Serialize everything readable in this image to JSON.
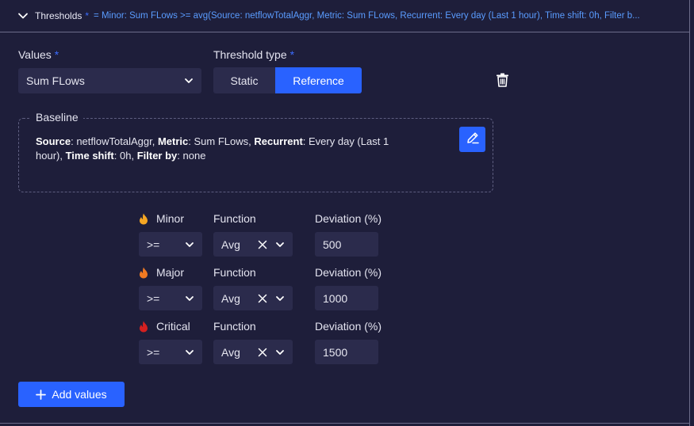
{
  "header": {
    "title": "Thresholds",
    "required_mark": "*",
    "summary": "= Minor: Sum FLows >= avg(Source: netflowTotalAggr, Metric: Sum FLows, Recurrent: Every day (Last 1 hour), Time shift: 0h, Filter b..."
  },
  "values_field": {
    "label": "Values",
    "required_mark": "*",
    "selected": "Sum FLows"
  },
  "threshold_type": {
    "label": "Threshold type",
    "required_mark": "*",
    "options": [
      "Static",
      "Reference"
    ],
    "selected": "Reference"
  },
  "baseline": {
    "legend": "Baseline",
    "source_label": "Source",
    "source": "netflowTotalAggr",
    "metric_label": "Metric",
    "metric": "Sum FLows",
    "recurrent_label": "Recurrent",
    "recurrent_a": "Every day (Last 1",
    "recurrent_b": "hour)",
    "time_shift_label": "Time shift",
    "time_shift": "0h",
    "filter_label": "Filter by",
    "filter": "none"
  },
  "severities": [
    {
      "name": "Minor",
      "operator": ">=",
      "function_label": "Function",
      "function": "Avg",
      "deviation_label": "Deviation (%)",
      "deviation": "500",
      "icon": "fire-icon",
      "color": "#f5a623"
    },
    {
      "name": "Major",
      "operator": ">=",
      "function_label": "Function",
      "function": "Avg",
      "deviation_label": "Deviation (%)",
      "deviation": "1000",
      "icon": "fire-icon",
      "color": "#f07a22"
    },
    {
      "name": "Critical",
      "operator": ">=",
      "function_label": "Function",
      "function": "Avg",
      "deviation_label": "Deviation (%)",
      "deviation": "1500",
      "icon": "fire-icon",
      "color": "#d42020"
    }
  ],
  "add_button": {
    "label": "Add values"
  },
  "colors": {
    "accent": "#2962ff",
    "background": "#1e1e3a",
    "field": "#2b2b4c",
    "link": "#5a9cff"
  }
}
